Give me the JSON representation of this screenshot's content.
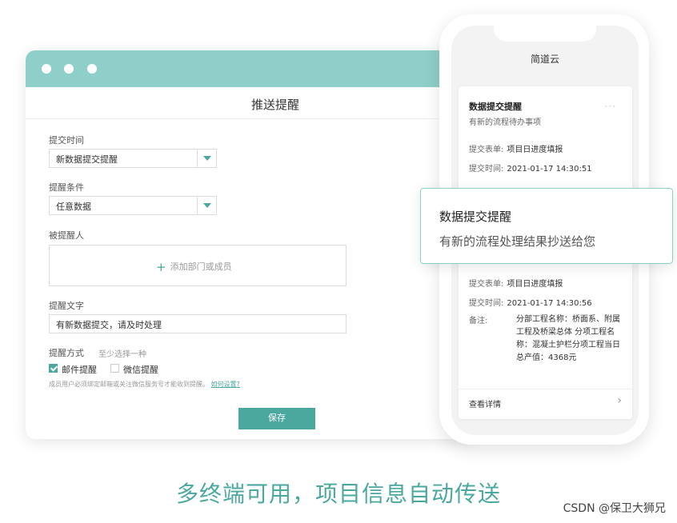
{
  "desktop": {
    "title": "推送提醒",
    "submit_time": {
      "label": "提交时间",
      "value": "新数据提交提醒"
    },
    "condition": {
      "label": "提醒条件",
      "value": "任意数据"
    },
    "recipient": {
      "label": "被提醒人",
      "add_label": "添加部门或成员"
    },
    "text": {
      "label": "提醒文字",
      "value": "有新数据提交，请及时处理"
    },
    "method": {
      "label": "提醒方式",
      "hint": "至少选择一种",
      "options": [
        {
          "label": "邮件提醒",
          "checked": true
        },
        {
          "label": "微信提醒",
          "checked": false
        }
      ]
    },
    "note": "成员用户必须绑定邮箱或关注微信服务号才能收到提醒。",
    "note_link": "如何设置?",
    "save_label": "保存"
  },
  "phone": {
    "app_title": "简道云",
    "card": {
      "title": "数据提交提醒",
      "subtitle": "有新的流程待办事项",
      "more": "···",
      "form_label": "提交表单:",
      "form_value": "项目日进度填报",
      "time_label": "提交时间:",
      "time_value": "2021-01-17 14:30:51",
      "form_label_2": "提交表单:",
      "form_value_2": "项目日进度填报",
      "time_label_2": "提交时间:",
      "time_value_2": "2021-01-17 14:30:56",
      "remark_label": "备注:",
      "remark_value": "分部工程名称：桥面系、附属工程及桥梁总体 分项工程名称：混凝土护栏分项工程当日总产值：4368元",
      "detail_label": "查看详情"
    }
  },
  "popup": {
    "title": "数据提交提醒",
    "subtitle": "有新的流程处理结果抄送给您"
  },
  "slogan": "多终端可用，项目信息自动传送",
  "watermark": "CSDN @保卫大狮兄",
  "colors": {
    "accent": "#4aa89f",
    "titlebar": "#8fcfc9"
  }
}
